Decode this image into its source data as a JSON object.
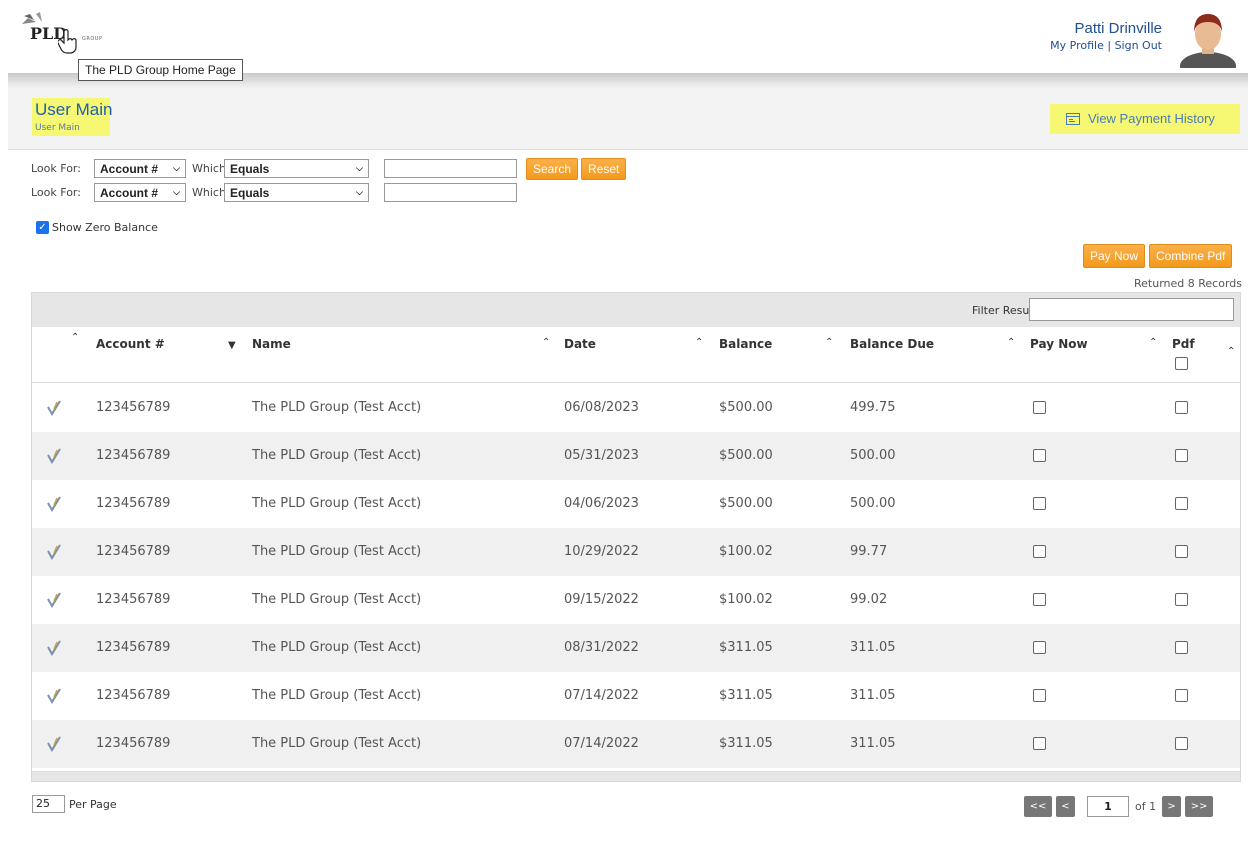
{
  "header": {
    "logo_text": "PLD",
    "logo_small": "GROUP",
    "tooltip": "The PLD Group Home Page",
    "user_name": "Patti Drinville",
    "my_profile": "My Profile",
    "separator": "|",
    "sign_out": "Sign Out"
  },
  "page": {
    "title": "User Main",
    "breadcrumb": "User Main",
    "view_payment_history": "View Payment History"
  },
  "search": {
    "look_for_label": "Look For:",
    "which_label": "Which",
    "rows": [
      {
        "field": "Account #",
        "operator": "Equals",
        "value": ""
      },
      {
        "field": "Account #",
        "operator": "Equals",
        "value": ""
      }
    ],
    "search_button": "Search",
    "reset_button": "Reset",
    "show_zero_balance_label": "Show Zero Balance",
    "show_zero_balance_checked": true
  },
  "actions": {
    "pay_now": "Pay Now",
    "combine_pdf": "Combine Pdf",
    "returned": "Returned 8 Records"
  },
  "table": {
    "filter_label": "Filter Results:",
    "columns": [
      "Account #",
      "Name",
      "Date",
      "Balance",
      "Balance Due",
      "Pay Now",
      "Pdf"
    ],
    "rows": [
      {
        "account": "123456789",
        "name": "The PLD Group (Test Acct)",
        "date": "06/08/2023",
        "balance": "$500.00",
        "balance_due": "499.75"
      },
      {
        "account": "123456789",
        "name": "The PLD Group (Test Acct)",
        "date": "05/31/2023",
        "balance": "$500.00",
        "balance_due": "500.00"
      },
      {
        "account": "123456789",
        "name": "The PLD Group (Test Acct)",
        "date": "04/06/2023",
        "balance": "$500.00",
        "balance_due": "500.00"
      },
      {
        "account": "123456789",
        "name": "The PLD Group (Test Acct)",
        "date": "10/29/2022",
        "balance": "$100.02",
        "balance_due": "99.77"
      },
      {
        "account": "123456789",
        "name": "The PLD Group (Test Acct)",
        "date": "09/15/2022",
        "balance": "$100.02",
        "balance_due": "99.02"
      },
      {
        "account": "123456789",
        "name": "The PLD Group (Test Acct)",
        "date": "08/31/2022",
        "balance": "$311.05",
        "balance_due": "311.05"
      },
      {
        "account": "123456789",
        "name": "The PLD Group (Test Acct)",
        "date": "07/14/2022",
        "balance": "$311.05",
        "balance_due": "311.05"
      },
      {
        "account": "123456789",
        "name": "The PLD Group (Test Acct)",
        "date": "07/14/2022",
        "balance": "$311.05",
        "balance_due": "311.05"
      }
    ]
  },
  "footer": {
    "per_page_value": "25",
    "per_page_label": "Per Page",
    "first": "<<",
    "prev": "<",
    "current_page": "1",
    "of_label": "of 1",
    "next": ">",
    "last": ">>"
  },
  "colors": {
    "accent_orange": "#f39a1c",
    "link_blue": "#1f5fa8",
    "highlight_yellow": "#f6f75a"
  }
}
